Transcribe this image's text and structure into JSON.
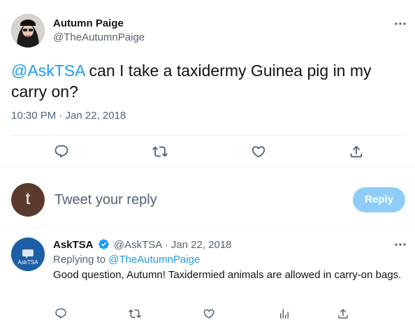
{
  "tweet": {
    "author_name": "Autumn Paige",
    "author_handle": "@TheAutumnPaige",
    "mention": "@AskTSA",
    "text": " can I take a taxidermy Guinea pig in my carry on?",
    "timestamp": "10:30 PM · Jan 22, 2018",
    "actions": {
      "reply_icon": "reply-icon",
      "retweet_icon": "retweet-icon",
      "like_icon": "heart-icon",
      "share_icon": "share-icon"
    }
  },
  "compose": {
    "avatar_letter": "t",
    "placeholder": "Tweet your reply",
    "button_label": "Reply"
  },
  "reply": {
    "author_name": "AskTSA",
    "author_handle": "@AskTSA",
    "date": " · Jan 22, 2018",
    "replying_prefix": "Replying to ",
    "replying_handle": "@TheAutumnPaige",
    "text": "Good question, Autumn! Taxidermied animals are allowed in carry-on bags.",
    "avatar_text": "AskTSA"
  },
  "colors": {
    "accent": "#1d9bf0",
    "muted": "#536471",
    "reply_button": "#8ecdf8",
    "tsa_blue": "#1c5fa6"
  }
}
